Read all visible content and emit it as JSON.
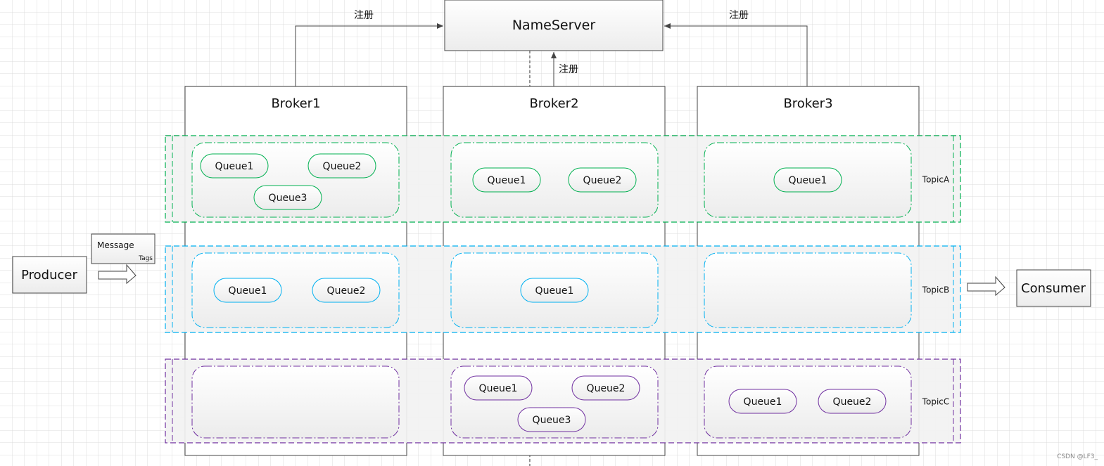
{
  "nameserver": {
    "label": "NameServer"
  },
  "register_labels": [
    "注册",
    "注册",
    "注册"
  ],
  "brokers": [
    {
      "label": "Broker1"
    },
    {
      "label": "Broker2"
    },
    {
      "label": "Broker3"
    }
  ],
  "topics": [
    {
      "label": "TopicA",
      "color": "#00b050",
      "brokers": [
        [
          "Queue1",
          "Queue2",
          "Queue3"
        ],
        [
          "Queue1",
          "Queue2"
        ],
        [
          "Queue1"
        ]
      ]
    },
    {
      "label": "TopicB",
      "color": "#00b0f0",
      "brokers": [
        [
          "Queue1",
          "Queue2"
        ],
        [
          "Queue1"
        ],
        []
      ]
    },
    {
      "label": "TopicC",
      "color": "#7030a0",
      "brokers": [
        [],
        [
          "Queue1",
          "Queue2",
          "Queue3"
        ],
        [
          "Queue1",
          "Queue2"
        ]
      ]
    }
  ],
  "producer": {
    "label": "Producer"
  },
  "message": {
    "label": "Message",
    "tags": "Tags"
  },
  "consumer": {
    "label": "Consumer"
  },
  "watermark": "CSDN @LF3_"
}
